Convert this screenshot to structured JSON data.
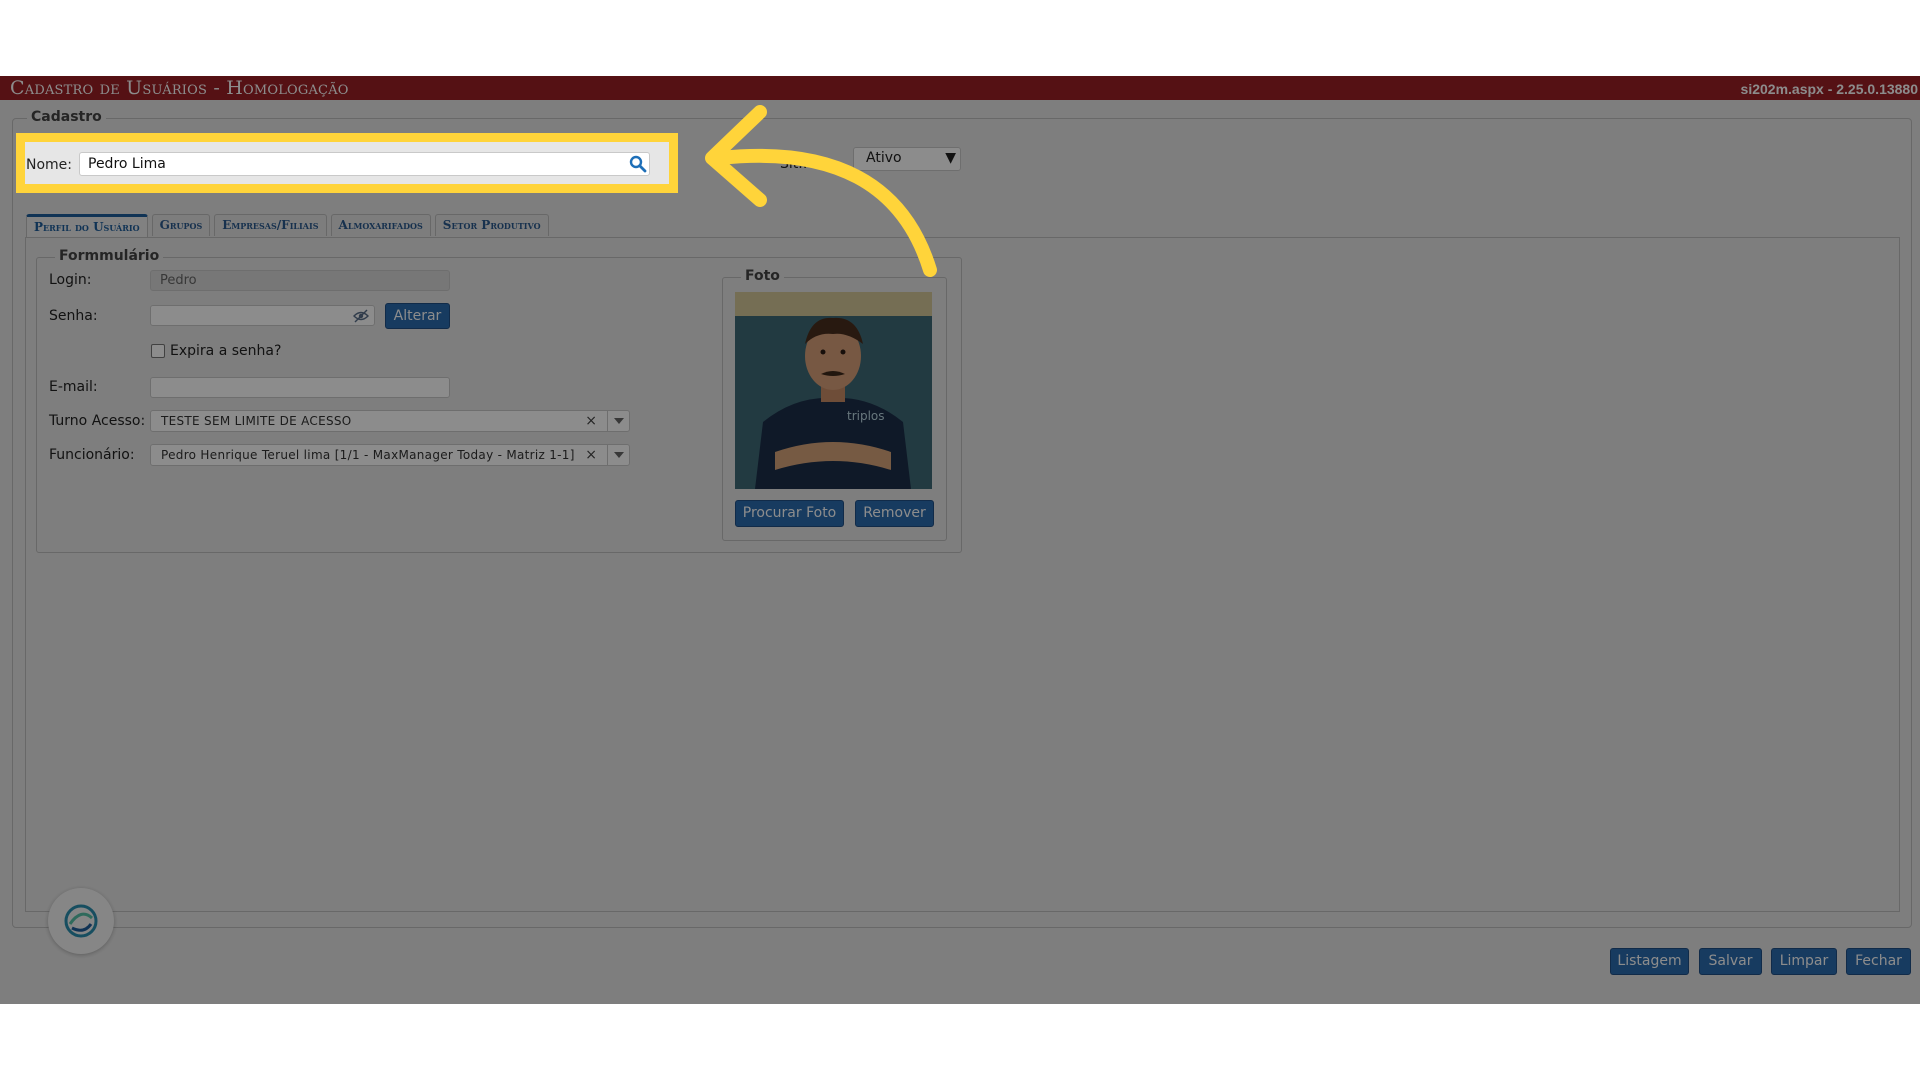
{
  "header": {
    "title": "Cadastro de Usuários  - Homologação",
    "version": "si202m.aspx - 2.25.0.13880"
  },
  "cadastro": {
    "legend": "Cadastro",
    "nome_label": "Nome:",
    "nome_value": "Pedro Lima",
    "status_value": "Ativo"
  },
  "tabs": [
    {
      "label": "Perfil do Usuário",
      "active": true
    },
    {
      "label": "Grupos",
      "active": false
    },
    {
      "label": "Empresas/Filiais",
      "active": false
    },
    {
      "label": "Almoxarifados",
      "active": false
    },
    {
      "label": "Setor Produtivo",
      "active": false
    }
  ],
  "form": {
    "legend": "Formmulário",
    "login_label": "Login:",
    "login_value": "Pedro",
    "senha_label": "Senha:",
    "alterar_label": "Alterar",
    "expira_label": "Expira a senha?",
    "expira_checked": false,
    "email_label": "E-mail:",
    "email_value": "",
    "turno_label": "Turno Acesso:",
    "turno_value": "TESTE SEM LIMITE DE ACESSO",
    "funcionario_label": "Funcionário:",
    "funcionario_value": "Pedro Henrique Teruel lima [1/1 - MaxManager Today - Matriz 1-1]"
  },
  "foto": {
    "legend": "Foto",
    "procurar_label": "Procurar Foto",
    "remover_label": "Remover"
  },
  "footer": {
    "listagem_label": "Listagem",
    "salvar_label": "Salvar",
    "limpar_label": "Limpar",
    "fechar_label": "Fechar"
  },
  "colors": {
    "titlebar": "#9c1f25",
    "primary_button": "#2b6cb0",
    "highlight": "#ffd43a"
  },
  "icons": {
    "search": "search-icon",
    "eye_off": "eye-slash-icon",
    "combo_clear": "close-icon",
    "combo_arrow": "chevron-down-icon",
    "assistant": "assistant-logo-icon",
    "annotation": "curved-arrow-icon"
  }
}
